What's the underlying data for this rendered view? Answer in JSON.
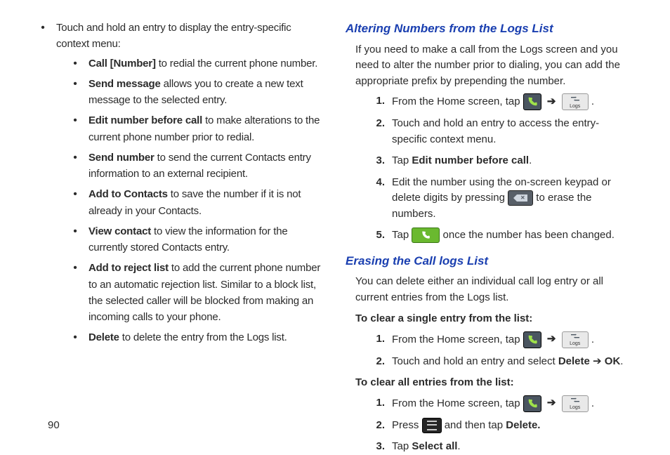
{
  "page_number": "90",
  "left": {
    "intro": "Touch and hold an entry to display the entry-specific context menu:",
    "items": [
      {
        "bold": "Call [Number]",
        "rest": " to redial the current phone number."
      },
      {
        "bold": "Send message",
        "rest": " allows you to create a new text message to the selected entry."
      },
      {
        "bold": "Edit number before call",
        "rest": " to make alterations to the current phone number prior to redial."
      },
      {
        "bold": "Send number",
        "rest": " to send the current Contacts entry information to an external recipient."
      },
      {
        "bold": "Add to Contacts",
        "rest": " to save the number if it is not already in your Contacts."
      },
      {
        "bold": "View contact",
        "rest": " to view the information for the currently stored Contacts entry."
      },
      {
        "bold": "Add to reject list",
        "rest": " to add the current phone number to an automatic rejection list. Similar to a block list, the selected caller will be blocked from making an incoming calls to your phone."
      },
      {
        "bold": "Delete",
        "rest": " to delete the entry from the Logs list."
      }
    ]
  },
  "right": {
    "section1": {
      "title": "Altering Numbers from the Logs List",
      "intro": "If you need to make a call from the Logs screen and you need to alter the number prior to dialing, you can add the appropriate prefix by prepending the number.",
      "steps": {
        "s1_pre": "From the Home screen, tap ",
        "s1_arrow": "➔",
        "s1_post": " .",
        "s2": "Touch and hold an entry to access the entry-specific context menu.",
        "s3a": "Tap ",
        "s3b": "Edit number before call",
        "s3c": ".",
        "s4a": "Edit the number using the on-screen keypad or delete digits by pressing ",
        "s4b": " to erase the numbers.",
        "s5a": "Tap ",
        "s5b": " once the number has been changed."
      }
    },
    "section2": {
      "title": "Erasing the Call logs List",
      "intro": "You can delete either an individual call log entry or all current entries from the Logs list.",
      "sub1": "To clear a single entry from the list:",
      "sub1_steps": {
        "s1_pre": "From the Home screen, tap ",
        "s1_arrow": "➔",
        "s1_post": " .",
        "s2a": "Touch and hold an entry and select ",
        "s2b": "Delete",
        "s2arrow": " ➔ ",
        "s2c": "OK",
        "s2d": "."
      },
      "sub2": "To clear all entries from the list:",
      "sub2_steps": {
        "s1_pre": "From the Home screen, tap ",
        "s1_arrow": "➔",
        "s1_post": " .",
        "s2a": "Press ",
        "s2b": " and then tap ",
        "s2c": "Delete.",
        "s3a": "Tap ",
        "s3b": "Select all",
        "s3c": "."
      }
    }
  },
  "icons": {
    "logs_label": "Logs"
  }
}
